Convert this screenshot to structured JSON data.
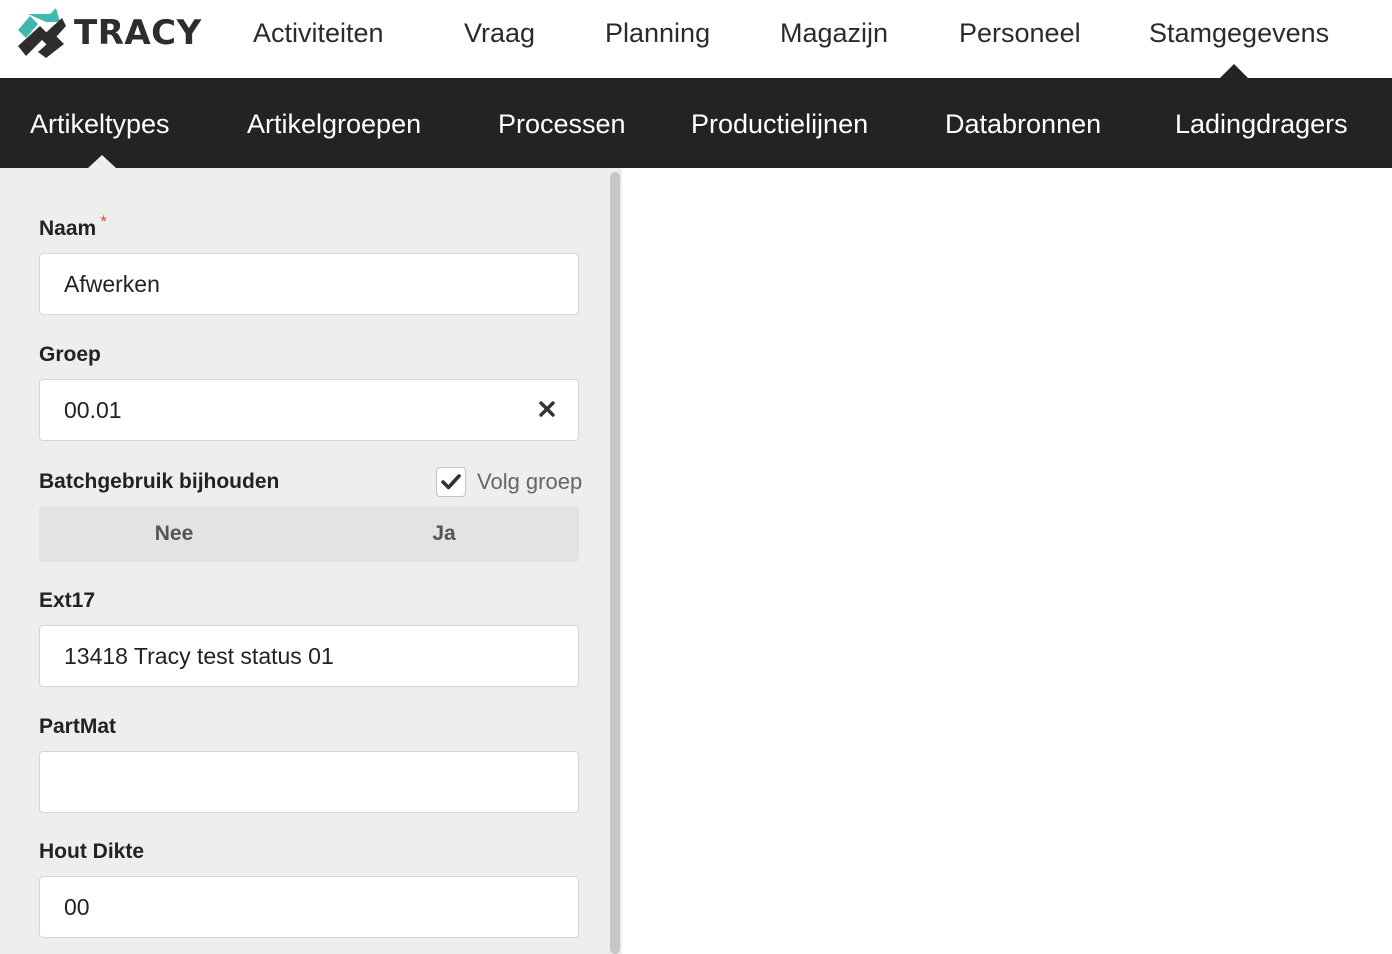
{
  "brand": {
    "name": "TRACY",
    "colors": {
      "teal": "#3fb8af",
      "dark": "#2d2d2d"
    }
  },
  "topnav": {
    "items": [
      "Activiteiten",
      "Vraag",
      "Planning",
      "Magazijn",
      "Personeel",
      "Stamgegevens"
    ],
    "active": "Stamgegevens"
  },
  "subnav": {
    "items": [
      "Artikeltypes",
      "Artikelgroepen",
      "Processen",
      "Productielijnen",
      "Databronnen",
      "Ladingdragers"
    ],
    "active": "Artikeltypes"
  },
  "form": {
    "naam": {
      "label": "Naam",
      "required_mark": "*",
      "value": "Afwerken"
    },
    "groep": {
      "label": "Groep",
      "value": "00.01",
      "clear_icon": "close-icon"
    },
    "batch": {
      "label": "Batchgebruik bijhouden",
      "follow_group_label": "Volg groep",
      "follow_group_checked": true,
      "options": [
        "Nee",
        "Ja"
      ]
    },
    "ext17": {
      "label": "Ext17",
      "value": "13418 Tracy test status 01"
    },
    "partmat": {
      "label": "PartMat",
      "value": ""
    },
    "hout_dikte": {
      "label": "Hout Dikte",
      "value": "00"
    }
  }
}
